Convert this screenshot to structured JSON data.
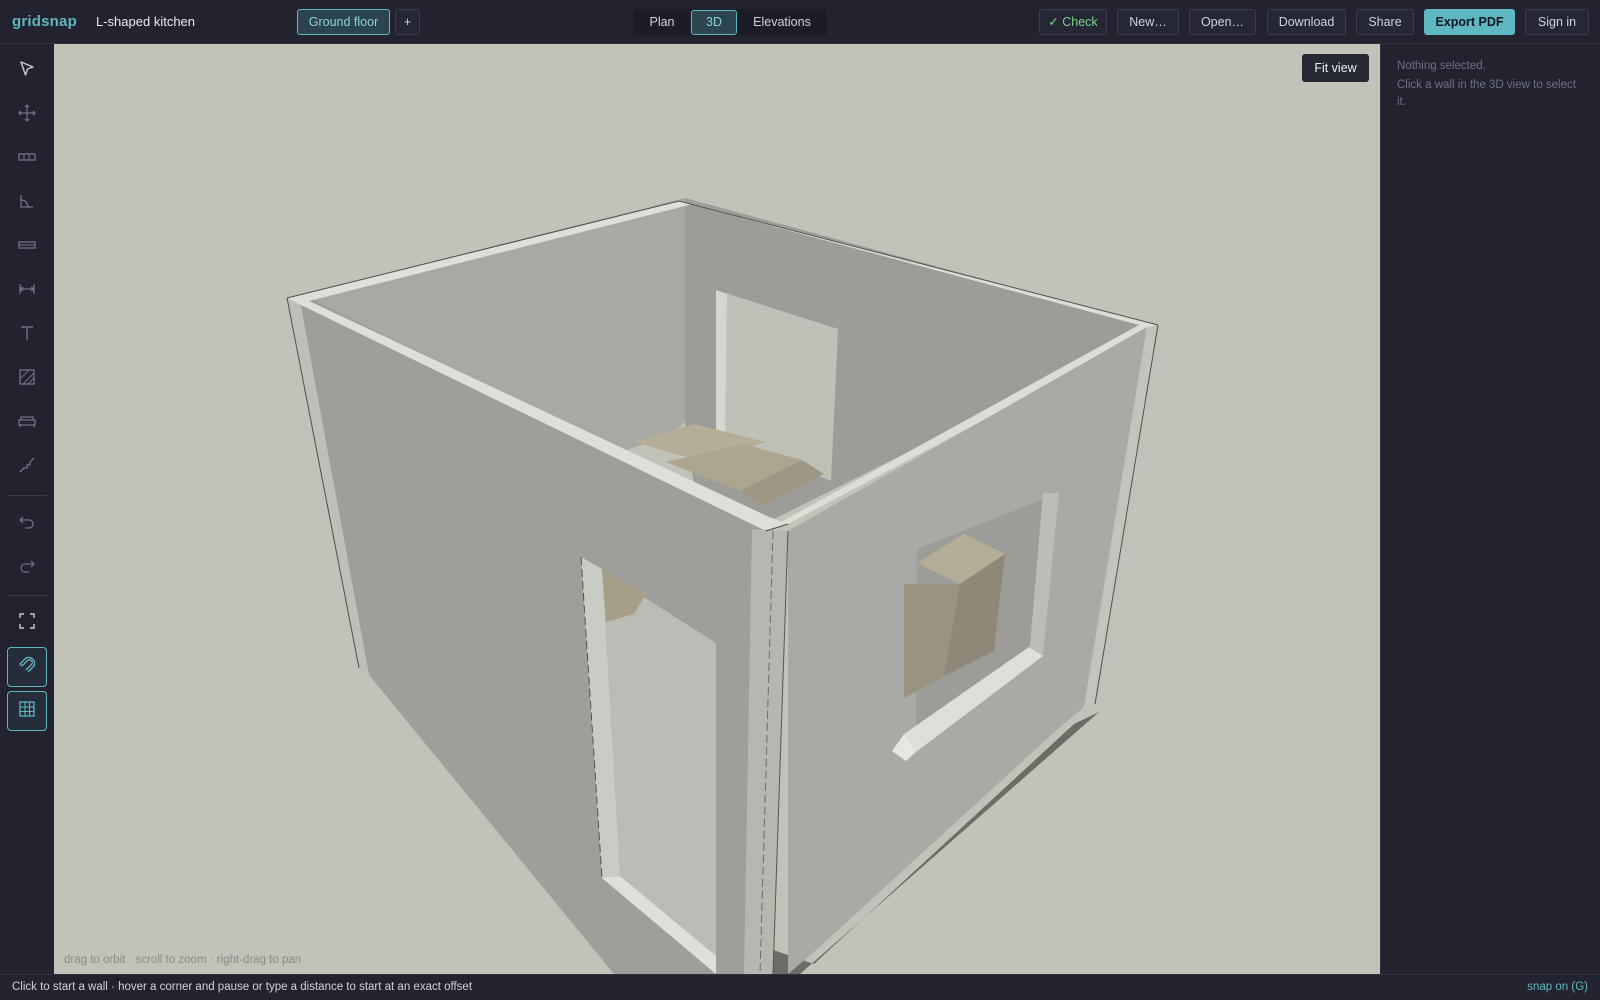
{
  "app": {
    "logo": "gridsnap",
    "document_title": "L-shaped kitchen"
  },
  "floors": {
    "current": "Ground floor",
    "add_label": "+"
  },
  "view_modes": {
    "plan": "Plan",
    "three_d": "3D",
    "elevations": "Elevations",
    "selected": "3D"
  },
  "header_actions": {
    "check": "✓ Check",
    "new": "New…",
    "open": "Open…",
    "download": "Download",
    "share": "Share",
    "export_pdf": "Export PDF",
    "sign_in": "Sign in"
  },
  "toolbar": {
    "tools": [
      {
        "name": "select-icon"
      },
      {
        "name": "move-icon"
      },
      {
        "name": "wall-icon"
      },
      {
        "name": "angle-icon"
      },
      {
        "name": "window-icon"
      },
      {
        "name": "dimension-icon"
      },
      {
        "name": "text-icon"
      },
      {
        "name": "hatch-area-icon"
      },
      {
        "name": "furniture-sofa-icon"
      },
      {
        "name": "stairs-icon"
      },
      {
        "name": "undo-icon"
      },
      {
        "name": "redo-icon"
      },
      {
        "name": "fit-screen-icon"
      },
      {
        "name": "snap-magnet-icon",
        "active": true
      },
      {
        "name": "grid-icon",
        "active": true
      }
    ]
  },
  "viewport": {
    "fit_view": "Fit view",
    "orbit_hint": "drag to orbit · scroll to zoom · right-drag to pan"
  },
  "inspector": {
    "title": "Nothing selected.",
    "hint": "Click a wall in the 3D view to select it."
  },
  "status": {
    "message": "Click to start a wall · hover a corner and pause or type a distance to start at an exact offset",
    "snap": "snap on (G)"
  },
  "colors": {
    "accent": "#5fb7c2",
    "viewport_bg": "#c1c2b8",
    "chrome_bg": "#22232f",
    "check_green": "#7ed08a"
  }
}
